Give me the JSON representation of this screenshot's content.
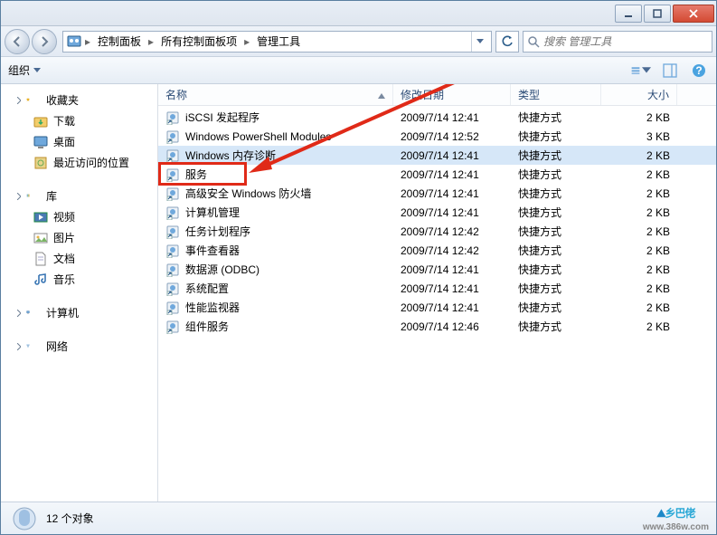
{
  "window": {
    "minimize": "minimize",
    "maximize": "maximize",
    "close": "close"
  },
  "breadcrumb": {
    "root_icon": "control-panel-icon",
    "items": [
      "控制面板",
      "所有控制面板项",
      "管理工具"
    ]
  },
  "search": {
    "placeholder": "搜索 管理工具",
    "icon": "search-icon"
  },
  "toolbar": {
    "organize_label": "组织",
    "view_icon": "view-icon",
    "panel_icon": "preview-pane-icon",
    "help_icon": "help-icon"
  },
  "sidebar": {
    "groups": [
      {
        "label": "收藏夹",
        "icon": "star-icon",
        "items": [
          {
            "label": "下载",
            "icon": "download-folder-icon"
          },
          {
            "label": "桌面",
            "icon": "desktop-icon"
          },
          {
            "label": "最近访问的位置",
            "icon": "recent-icon"
          }
        ]
      },
      {
        "label": "库",
        "icon": "libraries-icon",
        "items": [
          {
            "label": "视频",
            "icon": "video-icon"
          },
          {
            "label": "图片",
            "icon": "picture-icon"
          },
          {
            "label": "文档",
            "icon": "document-icon"
          },
          {
            "label": "音乐",
            "icon": "music-icon"
          }
        ]
      },
      {
        "label": "计算机",
        "icon": "computer-icon",
        "items": []
      },
      {
        "label": "网络",
        "icon": "network-icon",
        "items": []
      }
    ]
  },
  "columns": {
    "name": "名称",
    "date": "修改日期",
    "type": "类型",
    "size": "大小"
  },
  "files": [
    {
      "name": "iSCSI 发起程序",
      "date": "2009/7/14 12:41",
      "type": "快捷方式",
      "size": "2 KB"
    },
    {
      "name": "Windows PowerShell Modules",
      "date": "2009/7/14 12:52",
      "type": "快捷方式",
      "size": "3 KB"
    },
    {
      "name": "Windows 内存诊断",
      "date": "2009/7/14 12:41",
      "type": "快捷方式",
      "size": "2 KB"
    },
    {
      "name": "服务",
      "date": "2009/7/14 12:41",
      "type": "快捷方式",
      "size": "2 KB"
    },
    {
      "name": "高级安全 Windows 防火墙",
      "date": "2009/7/14 12:41",
      "type": "快捷方式",
      "size": "2 KB"
    },
    {
      "name": "计算机管理",
      "date": "2009/7/14 12:41",
      "type": "快捷方式",
      "size": "2 KB"
    },
    {
      "name": "任务计划程序",
      "date": "2009/7/14 12:42",
      "type": "快捷方式",
      "size": "2 KB"
    },
    {
      "name": "事件查看器",
      "date": "2009/7/14 12:42",
      "type": "快捷方式",
      "size": "2 KB"
    },
    {
      "name": "数据源 (ODBC)",
      "date": "2009/7/14 12:41",
      "type": "快捷方式",
      "size": "2 KB"
    },
    {
      "name": "系统配置",
      "date": "2009/7/14 12:41",
      "type": "快捷方式",
      "size": "2 KB"
    },
    {
      "name": "性能监视器",
      "date": "2009/7/14 12:41",
      "type": "快捷方式",
      "size": "2 KB"
    },
    {
      "name": "组件服务",
      "date": "2009/7/14 12:46",
      "type": "快捷方式",
      "size": "2 KB"
    }
  ],
  "highlighted_index": 3,
  "status": {
    "count_label": "12 个对象"
  },
  "watermark": {
    "brand": "乡巴佬",
    "url": "www.386w.com"
  }
}
